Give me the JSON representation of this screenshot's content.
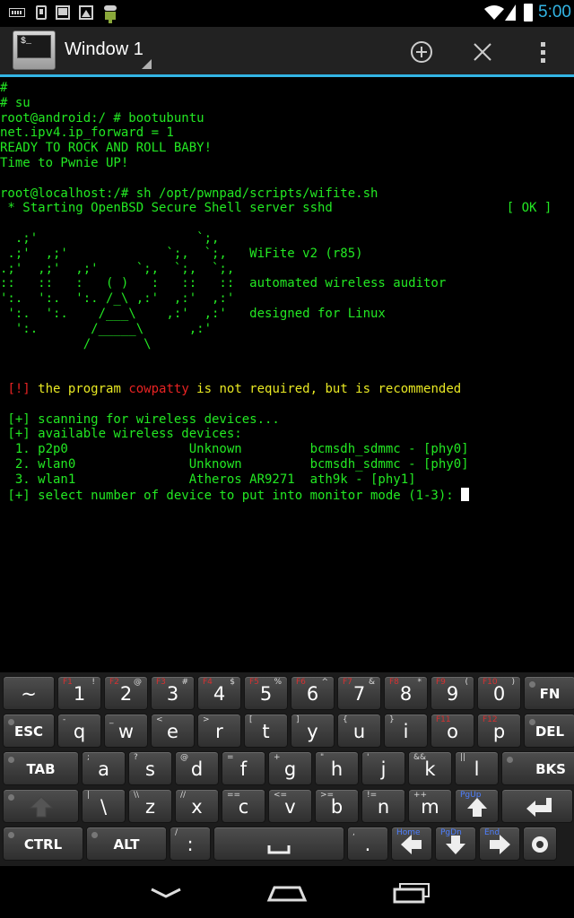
{
  "status_bar": {
    "time": "5:00",
    "accent_color": "#33b5e5"
  },
  "action_bar": {
    "window_title": "Window 1",
    "app_icon_prompt": "$_",
    "buttons": [
      "add-icon",
      "close-icon",
      "overflow-menu-icon"
    ]
  },
  "terminal": {
    "text_color": "#23e823",
    "lines": [
      "#",
      "# su",
      "root@android:/ # bootubuntu",
      "net.ipv4.ip_forward = 1",
      "READY TO ROCK AND ROLL BABY!",
      "Time to Pwnie UP!",
      "",
      "root@localhost:/# sh /opt/pwnpad/scripts/wifite.sh",
      " * Starting OpenBSD Secure Shell server sshd                       [ OK ]",
      "",
      "  .;'                     `;,",
      " .;'  ,;'             `;,  `;,   WiFite v2 (r85)",
      ".;'  ,;'  ,;'     `;,  `;,  `;,",
      "::   ::   :   ( )   :   ::   ::  automated wireless auditor",
      "':.  ':.  ':. /_\\ ,:'  ,:'  ,:'",
      " ':.  ':.    /___\\    ,:'  ,:'   designed for Linux",
      "  ':.       /_____\\      ,:'",
      "           /       \\",
      "",
      "",
      " [!] the program cowpatty is not required, but is recommended",
      "",
      " [+] scanning for wireless devices...",
      " [+] available wireless devices:",
      "  1. p2p0                Unknown         bcmsdh_sdmmc - [phy0]",
      "  2. wlan0               Unknown         bcmsdh_sdmmc - [phy0]",
      "  3. wlan1               Atheros AR9271  ath9k - [phy1]",
      " [+] select number of device to put into monitor mode (1-3): "
    ],
    "warning": {
      "prefix": " ",
      "bracket": "[!]",
      "before": " the program ",
      "program": "cowpatty",
      "after": " is not required, but is recommended"
    }
  },
  "keyboard": {
    "rows": [
      [
        {
          "main": "~",
          "sub": "",
          "name": "key-tilde"
        },
        {
          "main": "1",
          "sub": "F1",
          "sub2": "!",
          "name": "key-1"
        },
        {
          "main": "2",
          "sub": "F2",
          "sub2": "@",
          "name": "key-2"
        },
        {
          "main": "3",
          "sub": "F3",
          "sub2": "#",
          "name": "key-3"
        },
        {
          "main": "4",
          "sub": "F4",
          "sub2": "$",
          "name": "key-4"
        },
        {
          "main": "5",
          "sub": "F5",
          "sub2": "%",
          "name": "key-5"
        },
        {
          "main": "6",
          "sub": "F6",
          "sub2": "^",
          "name": "key-6"
        },
        {
          "main": "7",
          "sub": "F7",
          "sub2": "&",
          "name": "key-7"
        },
        {
          "main": "8",
          "sub": "F8",
          "sub2": "*",
          "name": "key-8"
        },
        {
          "main": "9",
          "sub": "F9",
          "sub2": "(",
          "name": "key-9"
        },
        {
          "main": "0",
          "sub": "F10",
          "sub2": ")",
          "name": "key-0"
        },
        {
          "main": "FN",
          "sub": "",
          "name": "key-fn"
        }
      ],
      [
        {
          "main": "ESC",
          "sub": "",
          "name": "key-esc"
        },
        {
          "main": "q",
          "sub": "-",
          "name": "key-q"
        },
        {
          "main": "w",
          "sub": "_",
          "name": "key-w"
        },
        {
          "main": "e",
          "sub": "<",
          "name": "key-e"
        },
        {
          "main": "r",
          "sub": ">",
          "name": "key-r"
        },
        {
          "main": "t",
          "sub": "[",
          "name": "key-t"
        },
        {
          "main": "y",
          "sub": "]",
          "name": "key-y"
        },
        {
          "main": "u",
          "sub": "{",
          "name": "key-u"
        },
        {
          "main": "i",
          "sub": "}",
          "name": "key-i"
        },
        {
          "main": "o",
          "sub": "F11",
          "name": "key-o"
        },
        {
          "main": "p",
          "sub": "F12",
          "name": "key-p"
        },
        {
          "main": "DEL",
          "sub": "",
          "name": "key-del"
        }
      ],
      [
        {
          "main": "TAB",
          "sub": "",
          "name": "key-tab"
        },
        {
          "main": "a",
          "sub": ";",
          "name": "key-a"
        },
        {
          "main": "s",
          "sub": "?",
          "name": "key-s"
        },
        {
          "main": "d",
          "sub": "@",
          "name": "key-d"
        },
        {
          "main": "f",
          "sub": "=",
          "name": "key-f"
        },
        {
          "main": "g",
          "sub": "+",
          "name": "key-g"
        },
        {
          "main": "h",
          "sub": "\"",
          "name": "key-h"
        },
        {
          "main": "j",
          "sub": "'",
          "name": "key-j"
        },
        {
          "main": "k",
          "sub": "&&",
          "name": "key-k"
        },
        {
          "main": "l",
          "sub": "||",
          "name": "key-l"
        },
        {
          "main": "BKS",
          "sub": "",
          "name": "key-backspace"
        }
      ],
      [
        {
          "main": "",
          "sub": "",
          "name": "key-shift",
          "icon": "shift-icon"
        },
        {
          "main": "\\",
          "sub": "|",
          "name": "key-backslash"
        },
        {
          "main": "z",
          "sub": "\\\\",
          "name": "key-z"
        },
        {
          "main": "x",
          "sub": "//",
          "name": "key-x"
        },
        {
          "main": "c",
          "sub": "==",
          "name": "key-c"
        },
        {
          "main": "v",
          "sub": "<=",
          "name": "key-v"
        },
        {
          "main": "b",
          "sub": ">=",
          "name": "key-b"
        },
        {
          "main": "n",
          "sub": "!=",
          "name": "key-n"
        },
        {
          "main": "m",
          "sub": "++",
          "name": "key-m"
        },
        {
          "main": "",
          "sub": "PgUp",
          "name": "key-up",
          "icon": "arrow-up-icon"
        },
        {
          "main": "",
          "sub": "",
          "name": "key-enter",
          "icon": "enter-icon"
        }
      ],
      [
        {
          "main": "CTRL",
          "sub": "",
          "name": "key-ctrl"
        },
        {
          "main": "ALT",
          "sub": "",
          "name": "key-alt"
        },
        {
          "main": ":",
          "sub": "/",
          "name": "key-colon"
        },
        {
          "main": "",
          "sub": "",
          "name": "key-space",
          "icon": "space-icon"
        },
        {
          "main": ".",
          "sub": ",",
          "name": "key-period"
        },
        {
          "main": "",
          "sub": "Home",
          "name": "key-left",
          "icon": "arrow-left-icon"
        },
        {
          "main": "",
          "sub": "PgDn",
          "name": "key-down",
          "icon": "arrow-down-icon"
        },
        {
          "main": "",
          "sub": "End",
          "name": "key-right",
          "icon": "arrow-right-icon"
        },
        {
          "main": "",
          "sub": "",
          "name": "key-settings",
          "icon": "settings-icon"
        }
      ]
    ]
  },
  "nav_bar": {
    "buttons": [
      "back-icon",
      "home-icon",
      "recents-icon"
    ]
  }
}
